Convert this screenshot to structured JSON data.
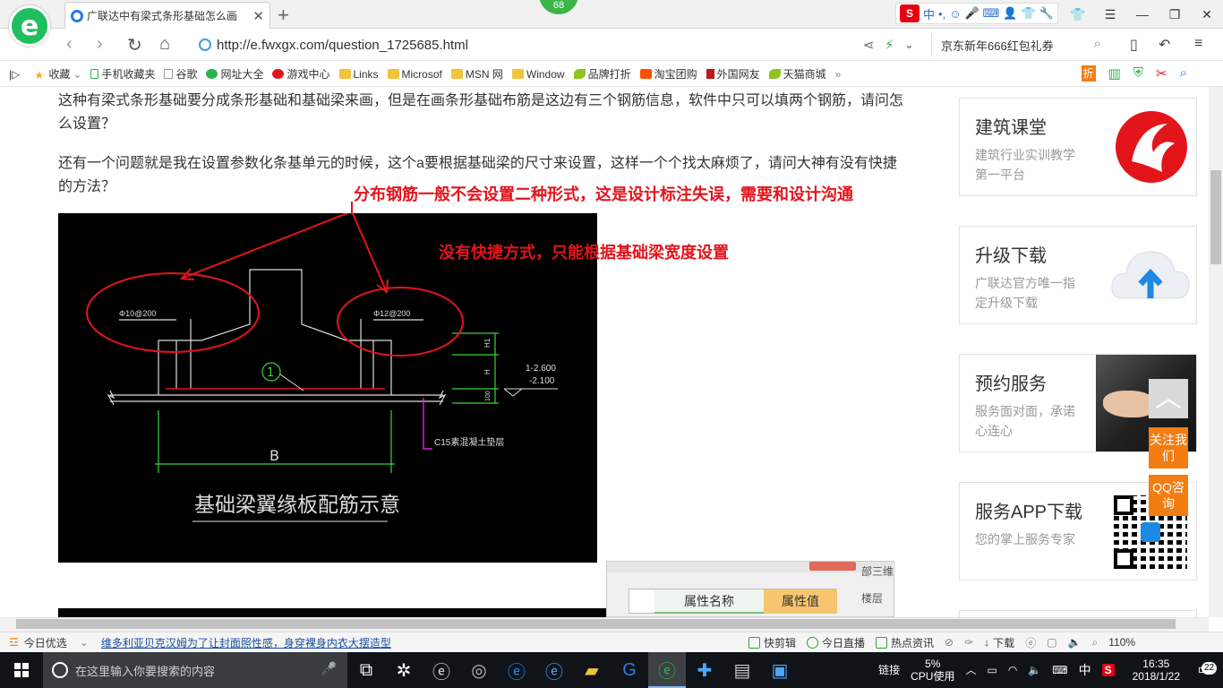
{
  "browser": {
    "tab_title": "广联达中有梁式条形基础怎么画",
    "badge": "68",
    "url": "http://e.fwxgx.com/question_1725685.html",
    "search_text": "京东新年666红包礼券",
    "ime_label": "中",
    "bookmarks": [
      {
        "label": "收藏",
        "icon": "star-icon"
      },
      {
        "label": "手机收藏夹",
        "icon": "phone-icon"
      },
      {
        "label": "谷歌",
        "icon": "page-icon"
      },
      {
        "label": "网址大全",
        "icon": "globe-icon"
      },
      {
        "label": "游戏中心",
        "icon": "game-icon"
      },
      {
        "label": "Links",
        "icon": "folder-icon"
      },
      {
        "label": "Microsof",
        "icon": "folder-icon"
      },
      {
        "label": "MSN 网",
        "icon": "folder-icon"
      },
      {
        "label": "Window",
        "icon": "folder-icon"
      },
      {
        "label": "品牌打折",
        "icon": "leaf-icon"
      },
      {
        "label": "淘宝团购",
        "icon": "taobao-icon"
      },
      {
        "label": "外国网友",
        "icon": "flag-icon"
      },
      {
        "label": "天猫商城",
        "icon": "leaf-icon"
      }
    ],
    "more_bookmarks": "»",
    "bm_right_label": "折"
  },
  "question": {
    "para1": "这种有梁式条形基础要分成条形基础和基础梁来画，但是在画条形基础布筋是这边有三个钢筋信息，软件中只可以填两个钢筋，请问怎么设置？",
    "para2": "还有一个问题就是我在设置参数化条基单元的时候，这个a要根据基础梁的尺寸来设置，这样一个个找太麻烦了，请问大神有没有快捷的方法？"
  },
  "annotations": {
    "answer1": "分布钢筋一般不会设置二种形式，这是设计标注失误，需要和设计沟通",
    "answer2": "没有快捷方式，只能根据基础梁宽度设置"
  },
  "cad": {
    "rebar_left": "Φ10@200",
    "rebar_right": "Φ12@200",
    "elev1": "1-2.600",
    "elev2": "-2.100",
    "dim_h": "H",
    "dim_h1": "H1",
    "dim_100": "100",
    "circle_label": "1",
    "width_label": "B",
    "concrete_label": "C15素混凝土垫层",
    "caption": "基础梁翼缘板配筋示意"
  },
  "popup": {
    "header_name": "属性名称",
    "header_value": "属性值",
    "side_text1": "部三维",
    "side_text2": "楼层"
  },
  "sidebar": {
    "cards": [
      {
        "title": "建筑课堂",
        "desc": "建筑行业实训教学第一平台"
      },
      {
        "title": "升级下载",
        "desc": "广联达官方唯一指定升级下载"
      },
      {
        "title": "预约服务",
        "desc": "服务面对面，承诺心连心"
      },
      {
        "title": "服务APP下载",
        "desc": "您的掌上服务专家"
      }
    ],
    "float_follow": "关注我们",
    "float_qq": "QQ咨询",
    "back_top": "︿"
  },
  "statusbar": {
    "news_label": "今日优选",
    "news_text": "维多利亚贝克汉姆为了让封面照性感，身穿裸身内衣大摆造型",
    "items": [
      "快剪辑",
      "今日直播",
      "热点资讯",
      "下载"
    ],
    "zoom": "110%"
  },
  "taskbar": {
    "search_placeholder": "在这里输入你要搜索的内容",
    "tray_link": "链接",
    "cpu_percent": "5%",
    "cpu_label": "CPU使用",
    "ime": "中",
    "time": "16:35",
    "date": "2018/1/22",
    "notifications": "22"
  }
}
